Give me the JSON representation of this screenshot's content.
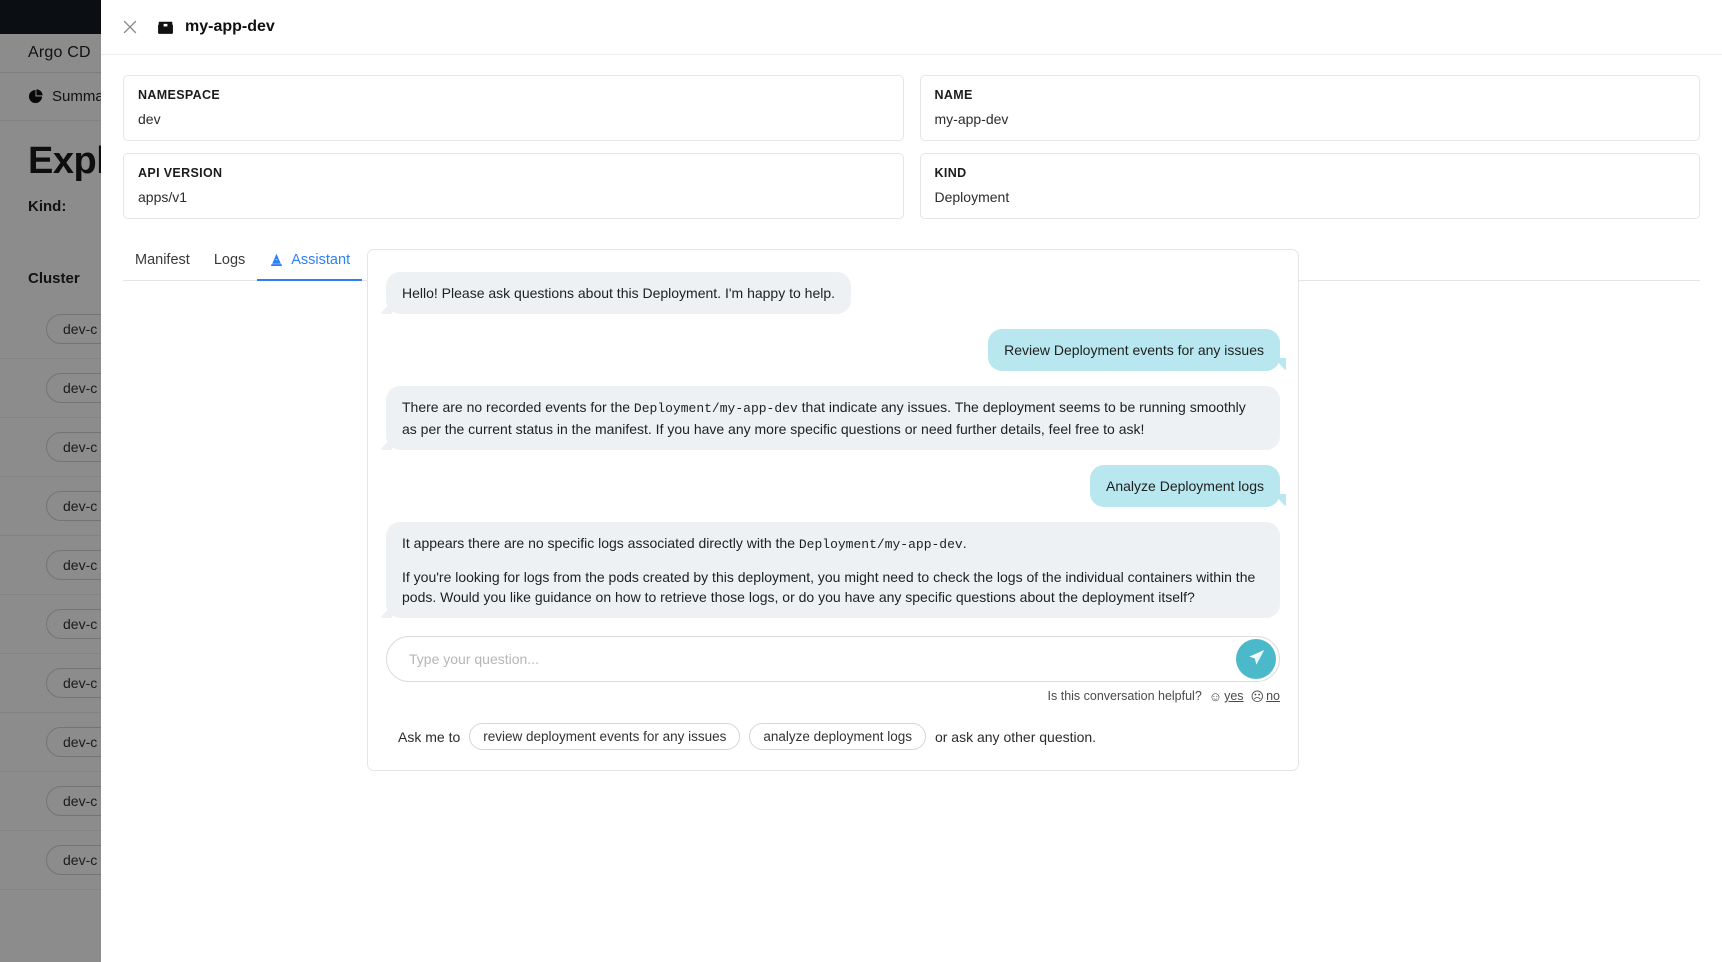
{
  "background": {
    "brand": "Argo CD",
    "nav_item": "Summary",
    "page_title": "Explore",
    "filter_kind_label": "Kind:",
    "filter_cluster_label": "Cluster",
    "list_items": [
      "dev-c",
      "dev-c",
      "dev-c",
      "dev-c",
      "dev-c",
      "dev-c",
      "dev-c",
      "dev-c",
      "dev-c",
      "dev-c"
    ]
  },
  "modal": {
    "close_icon": "close-icon",
    "resource_icon": "box-icon",
    "title": "my-app-dev",
    "info": [
      {
        "label": "NAMESPACE",
        "value": "dev"
      },
      {
        "label": "NAME",
        "value": "my-app-dev"
      },
      {
        "label": "API VERSION",
        "value": "apps/v1"
      },
      {
        "label": "KIND",
        "value": "Deployment"
      }
    ],
    "tabs": [
      {
        "label": "Manifest",
        "active": false,
        "icon": null
      },
      {
        "label": "Logs",
        "active": false,
        "icon": null
      },
      {
        "label": "Assistant",
        "active": true,
        "icon": "wizard-hat-icon"
      }
    ]
  },
  "chat": {
    "messages": [
      {
        "role": "bot",
        "wide": false,
        "paragraphs": [
          {
            "parts": [
              {
                "text": "Hello! Please ask questions about this Deployment. I'm happy to help.",
                "code": false
              }
            ]
          }
        ]
      },
      {
        "role": "user",
        "wide": false,
        "paragraphs": [
          {
            "parts": [
              {
                "text": "Review Deployment events for any issues",
                "code": false
              }
            ]
          }
        ]
      },
      {
        "role": "bot",
        "wide": true,
        "paragraphs": [
          {
            "parts": [
              {
                "text": "There are no recorded events for the ",
                "code": false
              },
              {
                "text": "Deployment/my-app-dev",
                "code": true
              },
              {
                "text": " that indicate any issues. The deployment seems to be running smoothly as per the current status in the manifest. If you have any more specific questions or need further details, feel free to ask!",
                "code": false
              }
            ]
          }
        ]
      },
      {
        "role": "user",
        "wide": false,
        "paragraphs": [
          {
            "parts": [
              {
                "text": "Analyze Deployment logs",
                "code": false
              }
            ]
          }
        ]
      },
      {
        "role": "bot",
        "wide": true,
        "paragraphs": [
          {
            "parts": [
              {
                "text": "It appears there are no specific logs associated directly with the ",
                "code": false
              },
              {
                "text": "Deployment/my-app-dev",
                "code": true
              },
              {
                "text": ".",
                "code": false
              }
            ]
          },
          {
            "parts": [
              {
                "text": "If you're looking for logs from the pods created by this deployment, you might need to check the logs of the individual containers within the pods. Would you like guidance on how to retrieve those logs, or do you have any specific questions about the deployment itself?",
                "code": false
              }
            ]
          }
        ]
      }
    ],
    "input_placeholder": "Type your question...",
    "input_value": "",
    "send_icon": "send-paper-plane-icon",
    "feedback_question": "Is this conversation helpful?",
    "feedback_yes": "yes",
    "feedback_no": "no",
    "feedback_yes_face": "☺",
    "feedback_no_face": "☹",
    "suggestions_prefix": "Ask me to",
    "suggestions": [
      "review deployment events for any issues",
      "analyze deployment logs"
    ],
    "suggestions_suffix": "or ask any other question."
  },
  "colors": {
    "accent_blue": "#2d7ff9",
    "user_bubble": "#b8e7ef",
    "bot_bubble": "#eef1f3",
    "send_button": "#4cb9cb",
    "topbar": "#141a21"
  }
}
